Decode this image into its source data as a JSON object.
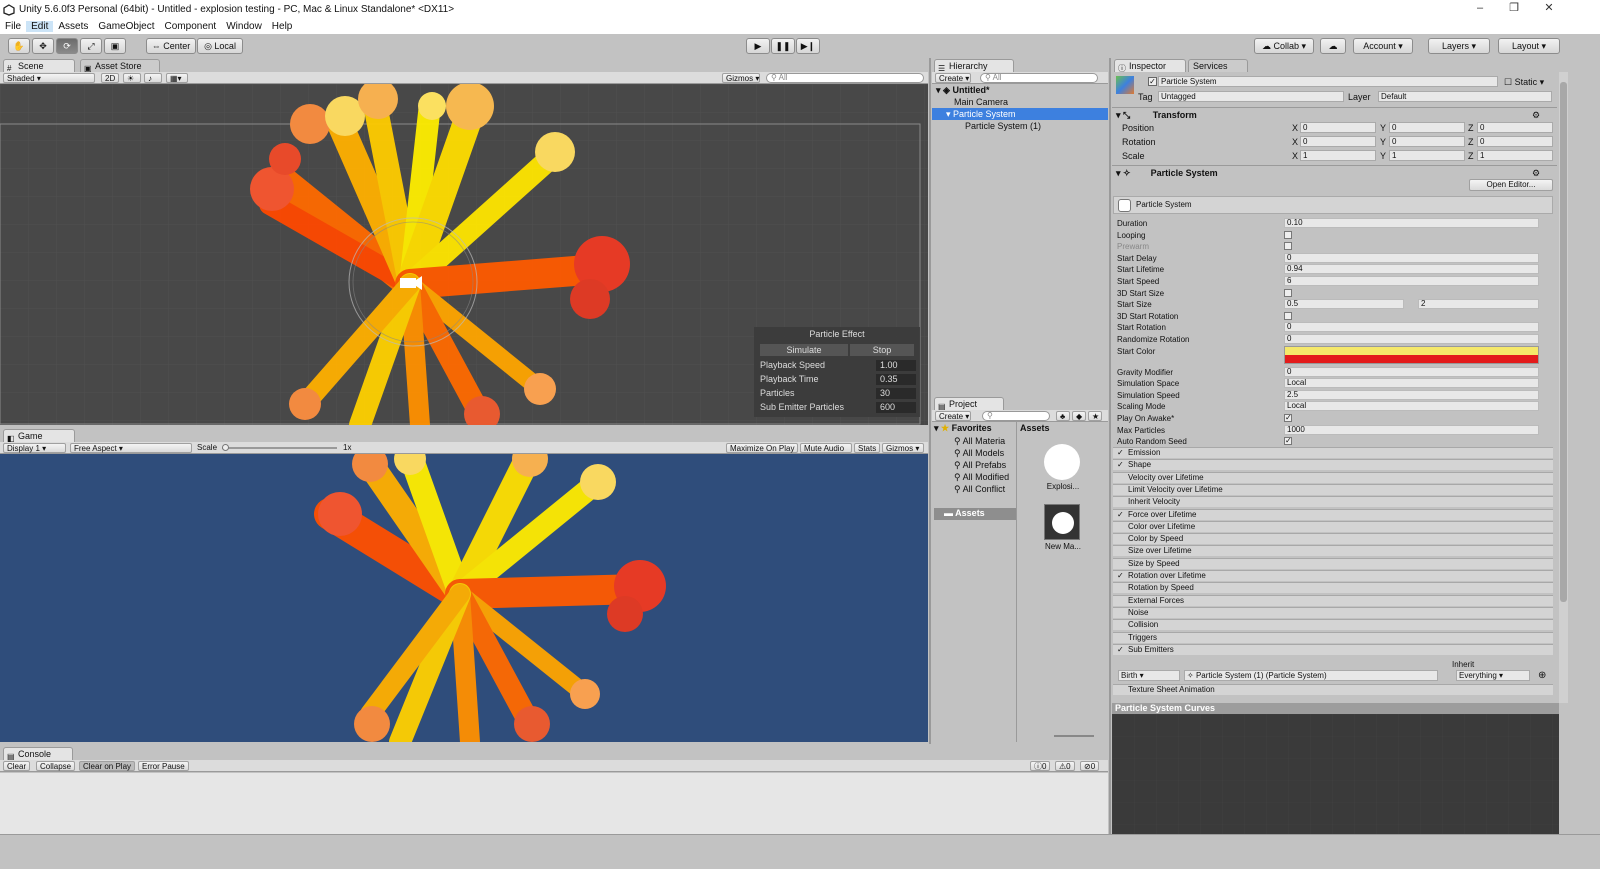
{
  "window": {
    "title": "Unity 5.6.0f3 Personal (64bit) - Untitled - explosion testing - PC, Mac & Linux Standalone* <DX11>",
    "minimize": "–",
    "maximize": "❐",
    "close": "✕"
  },
  "menu": [
    "File",
    "Edit",
    "Assets",
    "GameObject",
    "Component",
    "Window",
    "Help"
  ],
  "toolbar": {
    "center": "Center",
    "local": "Local",
    "collab": "Collab ▾",
    "account": "Account",
    "layers": "Layers",
    "layout": "Layout"
  },
  "scene": {
    "tab_scene": "Scene",
    "tab_asset_store": "Asset Store",
    "shading": "Shaded",
    "mode_2d": "2D",
    "gizmos": "Gizmos",
    "search_placeholder": "All",
    "particle_effect": {
      "title": "Particle Effect",
      "simulate": "Simulate",
      "stop": "Stop",
      "rows": [
        {
          "label": "Playback Speed",
          "value": "1.00"
        },
        {
          "label": "Playback Time",
          "value": "0.35"
        },
        {
          "label": "Particles",
          "value": "30"
        },
        {
          "label": "Sub Emitter Particles",
          "value": "600"
        }
      ]
    }
  },
  "game": {
    "tab": "Game",
    "display": "Display 1",
    "aspect": "Free Aspect",
    "scale_label": "Scale",
    "scale_value": "1x",
    "maximize": "Maximize On Play",
    "mute": "Mute Audio",
    "stats": "Stats",
    "gizmos": "Gizmos"
  },
  "hierarchy": {
    "tab": "Hierarchy",
    "create": "Create",
    "search_placeholder": "All",
    "scene_name": "Untitled*",
    "items": [
      "Main Camera",
      "Particle System",
      "Particle System (1)"
    ]
  },
  "project": {
    "tab": "Project",
    "create": "Create",
    "favorites": "Favorites",
    "favorite_items": [
      "All Materia",
      "All Models",
      "All Prefabs",
      "All Modified",
      "All Conflict"
    ],
    "assets_folder": "Assets",
    "assets_header": "Assets",
    "asset_items": [
      "Explosi...",
      "New Ma..."
    ]
  },
  "inspector": {
    "tab": "Inspector",
    "services_tab": "Services",
    "object_name": "Particle System",
    "static": "Static",
    "tag_label": "Tag",
    "tag_value": "Untagged",
    "layer_label": "Layer",
    "layer_value": "Default",
    "transform": {
      "title": "Transform",
      "rows": [
        {
          "label": "Position",
          "x": "0",
          "y": "0",
          "z": "0"
        },
        {
          "label": "Rotation",
          "x": "0",
          "y": "0",
          "z": "0"
        },
        {
          "label": "Scale",
          "x": "1",
          "y": "1",
          "z": "1"
        }
      ]
    },
    "particle_header": "Particle System",
    "open_editor": "Open Editor...",
    "ps_title": "Particle System",
    "props": [
      {
        "label": "Duration",
        "value": "0.10"
      },
      {
        "label": "Looping",
        "check": ""
      },
      {
        "label": "Prewarm",
        "check": ""
      },
      {
        "label": "Start Delay",
        "value": "0"
      },
      {
        "label": "Start Lifetime",
        "value": "0.94"
      },
      {
        "label": "Start Speed",
        "value": "6"
      },
      {
        "label": "3D Start Size",
        "check": ""
      },
      {
        "label": "Start Size",
        "value": "0.5",
        "value2": "2"
      },
      {
        "label": "3D Start Rotation",
        "check": ""
      },
      {
        "label": "Start Rotation",
        "value": "0"
      },
      {
        "label": "Randomize Rotation",
        "value": "0"
      },
      {
        "label": "Start Color",
        "value": ""
      },
      {
        "label": "Gravity Modifier",
        "value": "0"
      },
      {
        "label": "Simulation Space",
        "value": "Local"
      },
      {
        "label": "Simulation Speed",
        "value": "2.5"
      },
      {
        "label": "Scaling Mode",
        "value": "Local"
      },
      {
        "label": "Play On Awake*",
        "check": "✓"
      },
      {
        "label": "Max Particles",
        "value": "1000"
      },
      {
        "label": "Auto Random Seed",
        "check": "✓"
      }
    ],
    "modules": [
      {
        "label": "Emission",
        "check": "✓"
      },
      {
        "label": "Shape",
        "check": "✓"
      },
      {
        "label": "Velocity over Lifetime",
        "check": ""
      },
      {
        "label": "Limit Velocity over Lifetime",
        "check": ""
      },
      {
        "label": "Inherit Velocity",
        "check": ""
      },
      {
        "label": "Force over Lifetime",
        "check": "✓"
      },
      {
        "label": "Color over Lifetime",
        "check": ""
      },
      {
        "label": "Color by Speed",
        "check": ""
      },
      {
        "label": "Size over Lifetime",
        "check": ""
      },
      {
        "label": "Size by Speed",
        "check": ""
      },
      {
        "label": "Rotation over Lifetime",
        "check": "✓"
      },
      {
        "label": "Rotation by Speed",
        "check": ""
      },
      {
        "label": "External Forces",
        "check": ""
      },
      {
        "label": "Noise",
        "check": ""
      },
      {
        "label": "Collision",
        "check": ""
      },
      {
        "label": "Triggers",
        "check": ""
      },
      {
        "label": "Sub Emitters",
        "check": "✓"
      }
    ],
    "sub_emitter": {
      "inherit_label": "Inherit",
      "type": "Birth",
      "target": "Particle System (1) (Particle System)",
      "inherit": "Everything"
    },
    "texture_sheet": "Texture Sheet Animation",
    "curves_title": "Particle System Curves"
  },
  "console": {
    "tab": "Console",
    "clear": "Clear",
    "collapse": "Collapse",
    "clear_on_play": "Clear on Play",
    "error_pause": "Error Pause",
    "count_info": "0",
    "count_warn": "0",
    "count_err": "0"
  },
  "colors": {
    "start_color_top": "#f5e86a",
    "start_color_bottom": "#e31b1b",
    "selection": "#3d80df",
    "game_bg": "#2f4d7b",
    "scene_bg": "#484848"
  }
}
